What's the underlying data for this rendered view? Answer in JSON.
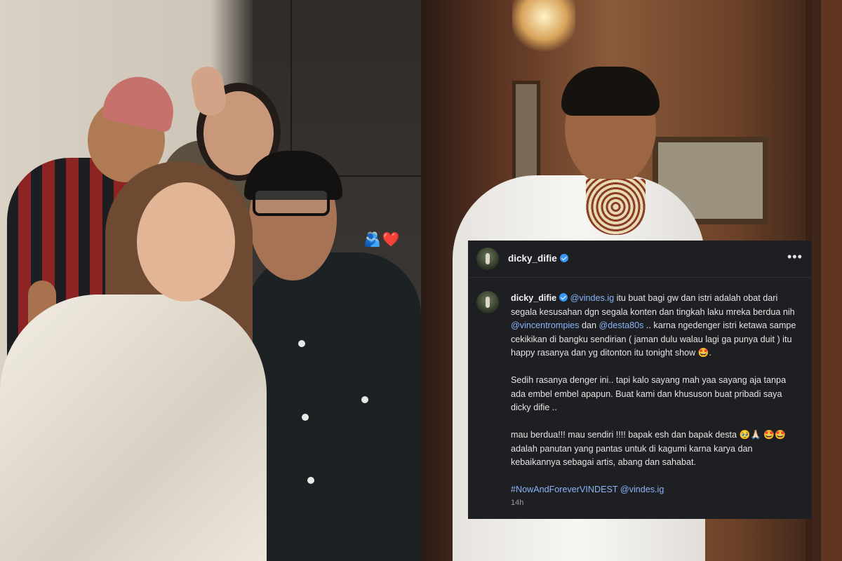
{
  "left_photo": {
    "sticker": "🫂❤️"
  },
  "post_header": {
    "username": "dicky_difie",
    "more_icon": "•••"
  },
  "comment": {
    "username": "dicky_difie",
    "mention1": "@vindes.ig",
    "text1": " itu buat bagi gw dan istri adalah obat dari segala kesusahan dgn segala konten dan tingkah laku mreka berdua nih ",
    "mention2": "@vincentrompies",
    "text2": " dan ",
    "mention3": "@desta80s",
    "text3": " .. karna ngedenger istri ketawa sampe cekikikan di bangku sendirian ( jaman dulu walau lagi ga punya duit ) itu happy rasanya dan yg ditonton itu tonight show 🤩.",
    "paragraph2": "Sedih rasanya denger ini.. tapi kalo sayang mah yaa sayang aja tanpa ada embel embel apapun. Buat kami dan khususon buat pribadi saya dicky difie ..",
    "paragraph3": "mau berdua!!! mau sendiri !!!! bapak esh dan bapak desta 🥹🙏🏻 🤩🤩 adalah panutan yang pantas untuk di kagumi karna karya dan kebaikannya sebagai artis, abang dan sahabat.",
    "hashtag": "#NowAndForeverVINDEST",
    "mention4": "@vindes.ig",
    "timestamp": "14h"
  },
  "colors": {
    "card_bg": "#1e1f22",
    "mention": "#8ab4f8",
    "verified_badge": "#3897f0"
  }
}
